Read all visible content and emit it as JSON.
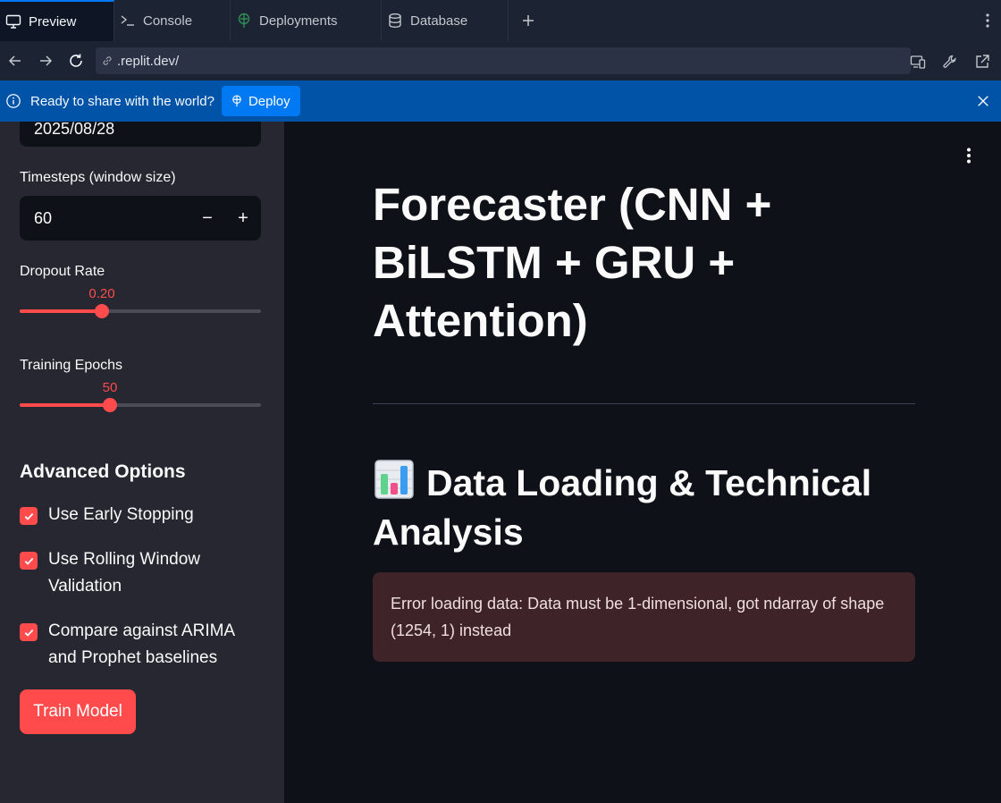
{
  "tabs": [
    {
      "label": "Preview",
      "icon": "monitor-icon",
      "active": true
    },
    {
      "label": "Console",
      "icon": "terminal-icon",
      "active": false
    },
    {
      "label": "Deployments",
      "icon": "deploy-icon",
      "active": false
    },
    {
      "label": "Database",
      "icon": "database-icon",
      "active": false
    }
  ],
  "addressbar": {
    "url": ".replit.dev/"
  },
  "banner": {
    "message": "Ready to share with the world?",
    "deploy_label": "Deploy"
  },
  "sidebar": {
    "date_value": "2025/08/28",
    "timesteps": {
      "label": "Timesteps (window size)",
      "value": "60",
      "minus": "−",
      "plus": "+"
    },
    "dropout": {
      "label": "Dropout Rate",
      "value_text": "0.20",
      "fraction": 0.34
    },
    "epochs": {
      "label": "Training Epochs",
      "value_text": "50",
      "fraction": 0.375
    },
    "advanced": {
      "title": "Advanced Options",
      "options": [
        {
          "label": "Use Early Stopping",
          "checked": true
        },
        {
          "label": "Use Rolling Window Validation",
          "checked": true
        },
        {
          "label": "Compare against ARIMA and Prophet baselines",
          "checked": true
        }
      ]
    },
    "train_label": "Train Model"
  },
  "main": {
    "title": "Forecaster (CNN + BiLSTM + GRU + Attention)",
    "section_heading": "Data Loading & Technical Analysis",
    "section_icon": "bar-chart-emoji-icon",
    "error": "Error loading data: Data must be 1-dimensional, got ndarray of shape (1254, 1) instead"
  },
  "colors": {
    "accent": "#ff4b4b",
    "deploy_banner": "#0053a6",
    "error_bg": "#3e2428"
  }
}
